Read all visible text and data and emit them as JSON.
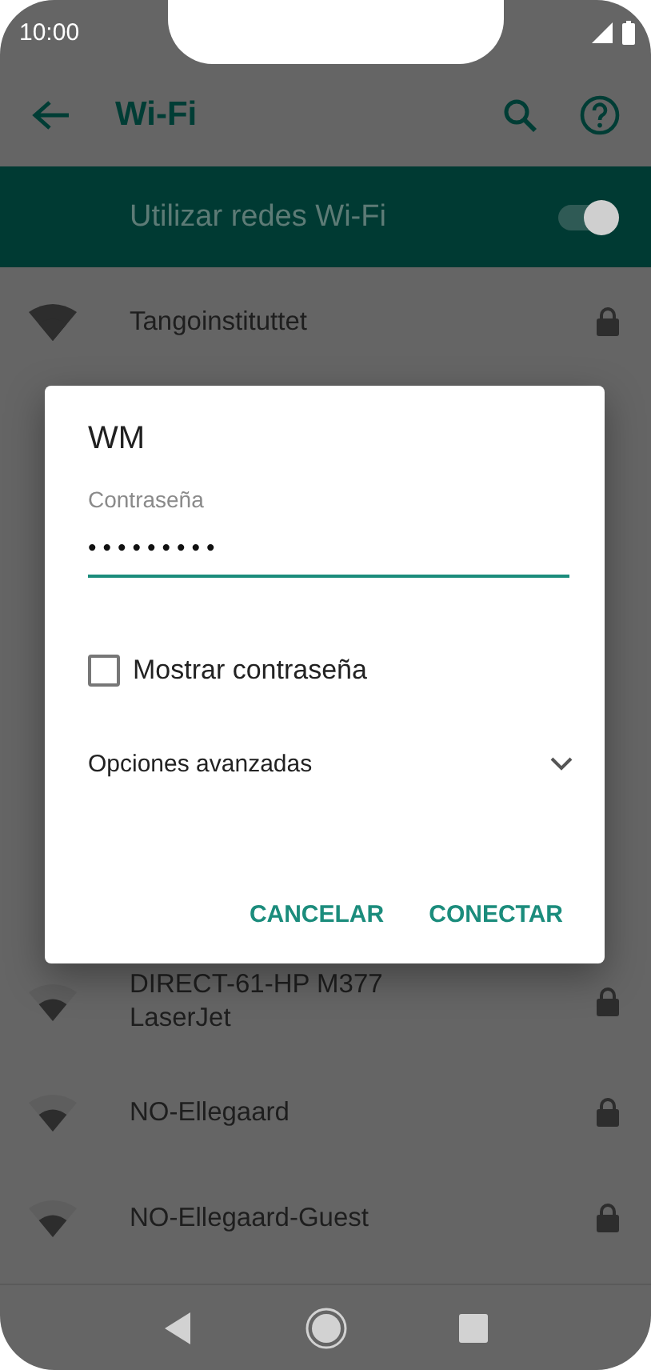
{
  "status_bar": {
    "time": "10:00"
  },
  "app_bar": {
    "title": "Wi-Fi"
  },
  "wifi_toggle": {
    "label": "Utilizar redes Wi-Fi",
    "on": true
  },
  "networks_top": [
    {
      "name": "Tangoinstituttet",
      "kind": "strong",
      "secured": true
    }
  ],
  "networks_bottom": [
    {
      "name": "DIRECT-61-HP M377 LaserJet",
      "kind": "weak",
      "secured": true
    },
    {
      "name": "NO-Ellegaard",
      "kind": "weak",
      "secured": true
    },
    {
      "name": "NO-Ellegaard-Guest",
      "kind": "weak",
      "secured": true
    }
  ],
  "dialog": {
    "title": "WM",
    "password_label": "Contraseña",
    "password_value": "•••••••••",
    "show_password": {
      "label": "Mostrar contraseña",
      "checked": false
    },
    "advanced": {
      "label": "Opciones avanzadas",
      "expanded": false
    },
    "buttons": [
      "CANCELAR",
      "CONECTAR"
    ]
  }
}
